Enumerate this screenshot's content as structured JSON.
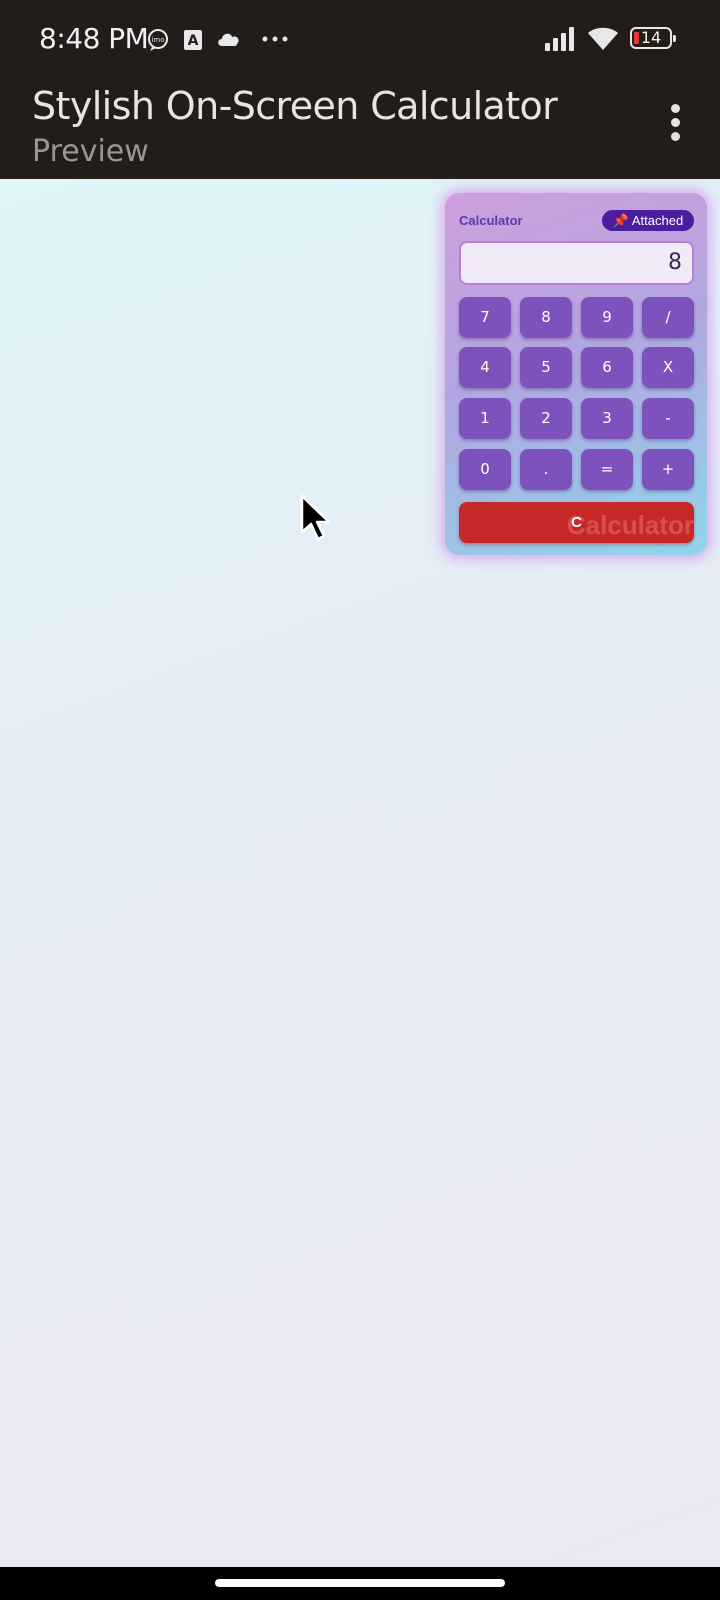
{
  "status_bar": {
    "time": "8:48 PM",
    "battery_level": "14",
    "notification_icons": [
      "imo-icon",
      "font-icon",
      "cloud-icon",
      "more-dots-icon"
    ],
    "system_icons": [
      "signal-icon",
      "wifi-icon",
      "battery-icon"
    ]
  },
  "app_bar": {
    "title": "Stylish On-Screen Calculator",
    "subtitle": "Preview",
    "menu_icon": "more-vertical-icon"
  },
  "calculator": {
    "label": "Calculator",
    "badge": "📌 Attached",
    "display_value": "8",
    "keys": [
      [
        "7",
        "8",
        "9",
        "/"
      ],
      [
        "4",
        "5",
        "6",
        "X"
      ],
      [
        "1",
        "2",
        "3",
        "-"
      ],
      [
        "0",
        ".",
        "=",
        "+"
      ]
    ],
    "clear_label": "C",
    "clear_watermark": "Calculator"
  },
  "colors": {
    "status_bar_bg": "#221d1b",
    "key_bg": "#7d52bc",
    "clear_bg": "#c62828",
    "badge_bg": "#4a1e9e"
  }
}
